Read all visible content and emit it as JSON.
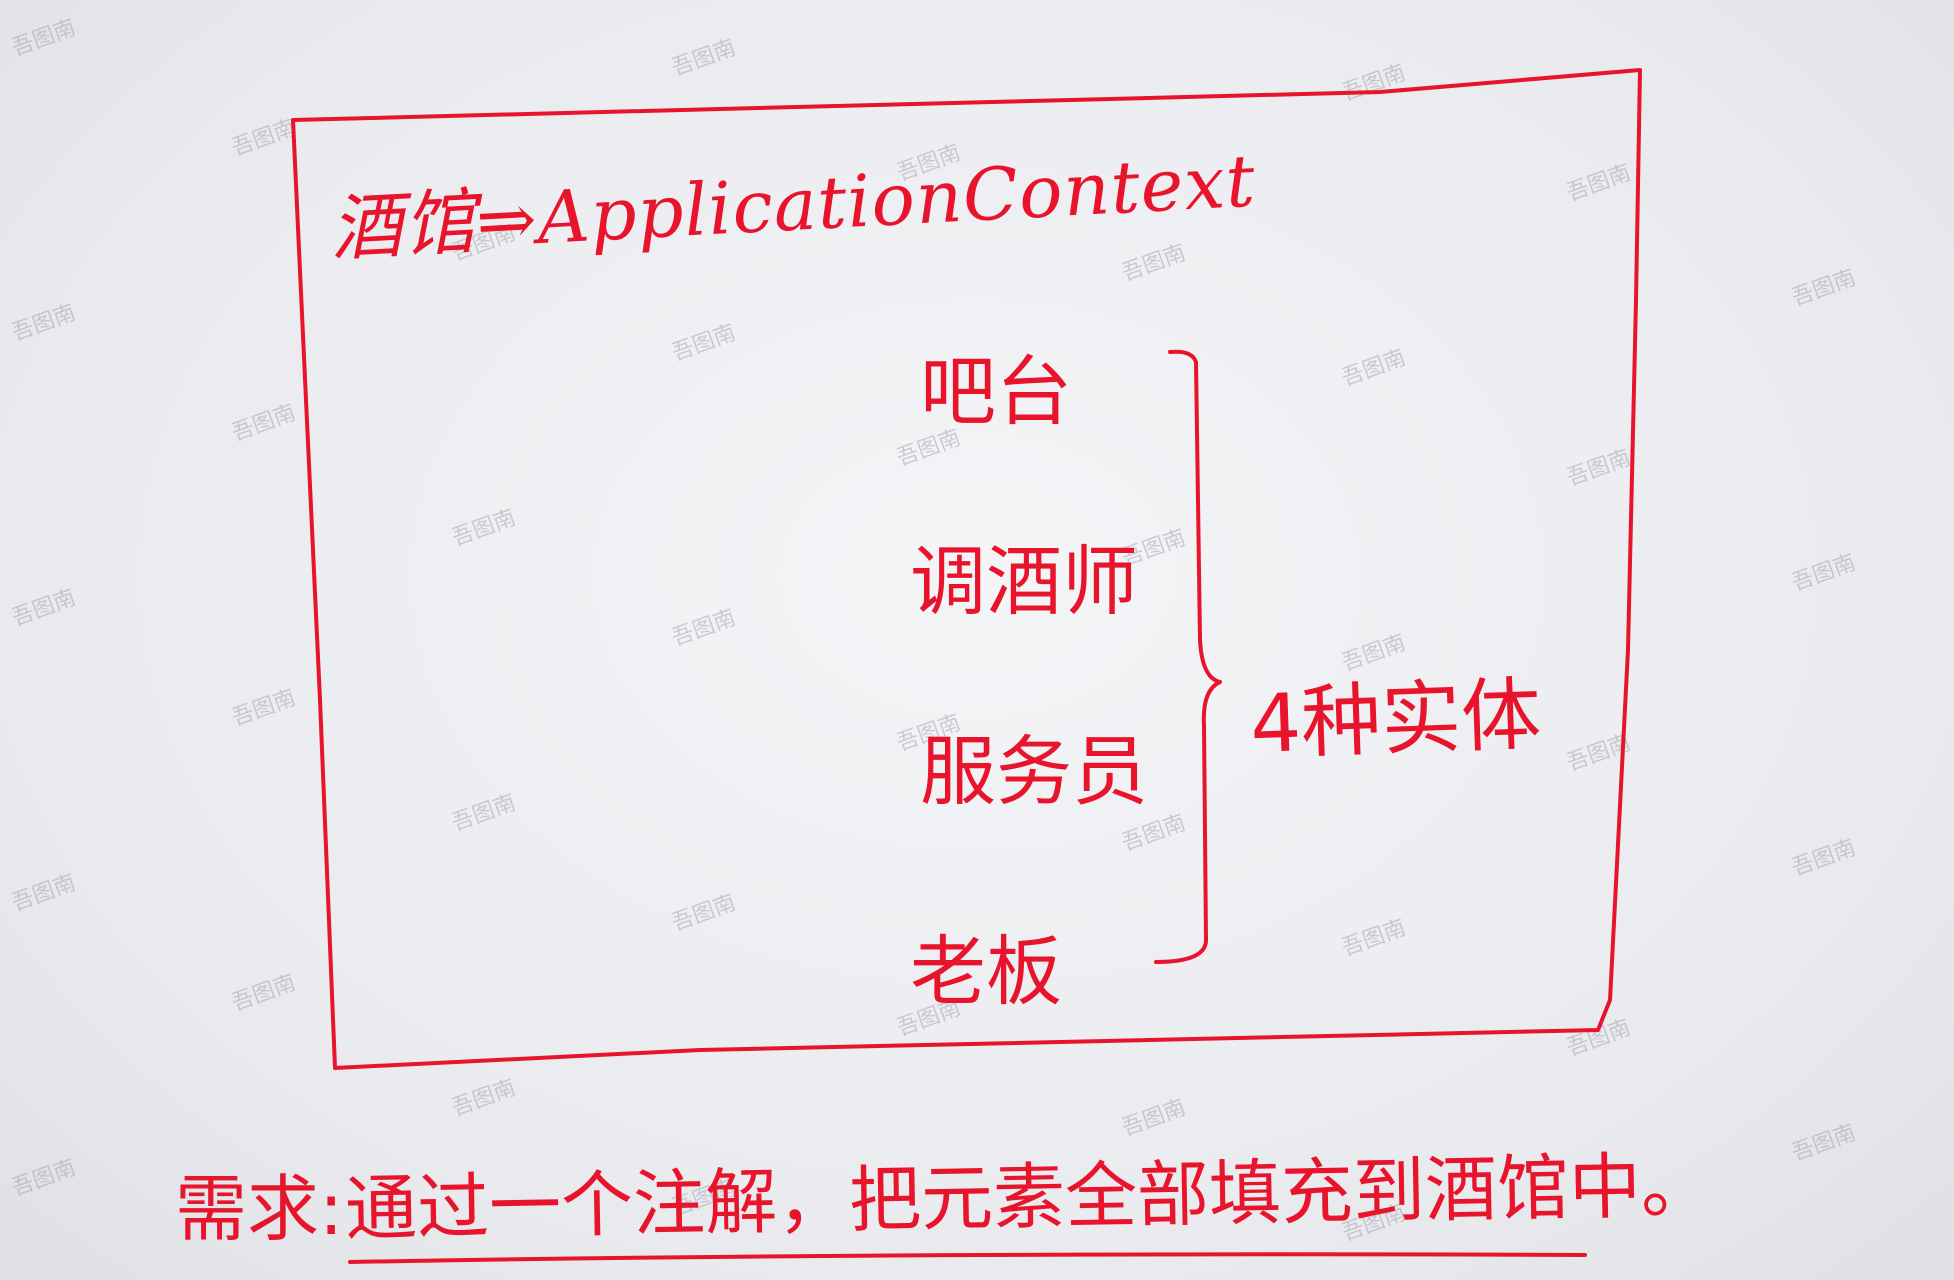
{
  "diagram": {
    "title": "酒馆⇒ApplicationContext",
    "entities": [
      "吧台",
      "调酒师",
      "服务员",
      "老板"
    ],
    "brace_label": "4种实体",
    "requirement_label": "需求:",
    "requirement_text": "通过一个注解，把元素全部填充到酒馆中。",
    "ink_color": "#e8142c"
  },
  "watermark": "吾图南"
}
